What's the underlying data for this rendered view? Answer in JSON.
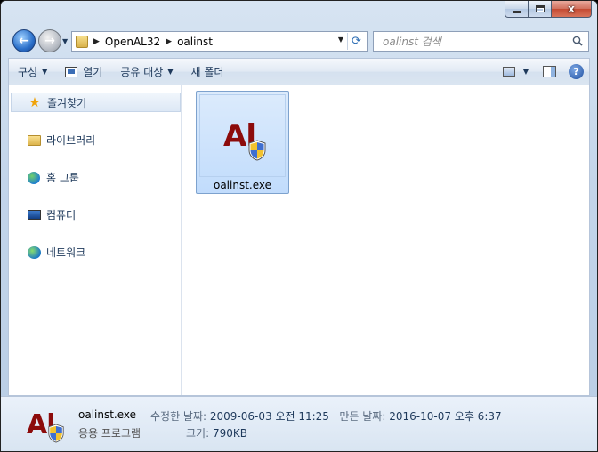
{
  "window": {
    "caption_close": "x"
  },
  "address_bar": {
    "segments": [
      "OpenAL32",
      "oalinst"
    ]
  },
  "search": {
    "placeholder": "oalinst 검색"
  },
  "toolbar": {
    "organize": "구성",
    "open": "열기",
    "share": "공유 대상",
    "new_folder": "새 폴더",
    "help": "?"
  },
  "sidebar": {
    "items": [
      {
        "label": "즐겨찾기",
        "icon": "star-icon"
      },
      {
        "label": "라이브러리",
        "icon": "library-icon"
      },
      {
        "label": "홈 그룹",
        "icon": "homegroup-icon"
      },
      {
        "label": "컴퓨터",
        "icon": "computer-icon"
      },
      {
        "label": "네트워크",
        "icon": "network-icon"
      }
    ]
  },
  "files": [
    {
      "name": "oalinst.exe",
      "icon": "openal-app-icon",
      "logo_text": "Al"
    }
  ],
  "details": {
    "name": "oalinst.exe",
    "type": "응용 프로그램",
    "modified_label": "수정한 날짜:",
    "modified_value": "2009-06-03 오전 11:25",
    "created_label": "만든 날짜:",
    "created_value": "2016-10-07 오후 6:37",
    "size_label": "크기:",
    "size_value": "790KB",
    "logo_text": "Al"
  },
  "colors": {
    "accent": "#1e395b",
    "logo_red": "#8c0b0b",
    "selection": "#c1dcfc"
  }
}
